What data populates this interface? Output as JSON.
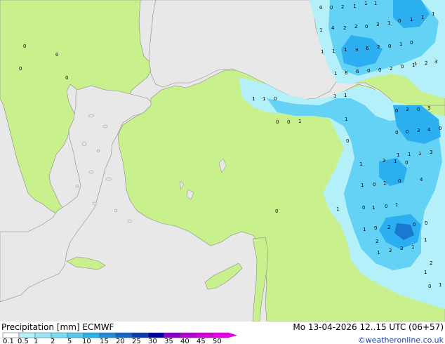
{
  "colors": {
    "sea": "#e8e8e8",
    "land": "#c8f08c",
    "precip_light": "#b4f0fa",
    "precip_mid": "#64d2f5",
    "precip_heavy": "#2baff0",
    "precip_strong": "#1a78d2",
    "coast": "#8c8c8c",
    "credit": "#1a3fb5"
  },
  "footer": {
    "title": "Precipitation [mm] ECMWF",
    "timestamp": "Mo 13-04-2026 12..15 UTC (06+57)",
    "credit": "©weatheronline.co.uk",
    "scale_labels": [
      "0.1",
      "0.5",
      "1",
      "2",
      "5",
      "10",
      "15",
      "20",
      "25",
      "30",
      "35",
      "40",
      "45",
      "50"
    ],
    "scale_colors": [
      "#ffffff",
      "#b4f0fa",
      "#96e6f8",
      "#78dcf5",
      "#50c8f0",
      "#28b4eb",
      "#1e8cdc",
      "#1464c8",
      "#0a3cb4",
      "#0000a0",
      "#8c00c8",
      "#b400d2",
      "#d200dc",
      "#e600e6"
    ]
  },
  "precip_values": [
    {
      "v": "0"
    },
    {
      "v": "0"
    },
    {
      "v": "2"
    },
    {
      "v": "1"
    },
    {
      "v": "1"
    },
    {
      "v": "1"
    },
    {
      "v": "1"
    },
    {
      "v": "4"
    },
    {
      "v": "2"
    },
    {
      "v": "2"
    },
    {
      "v": "0"
    },
    {
      "v": "3"
    },
    {
      "v": "1"
    },
    {
      "v": "0"
    },
    {
      "v": "1"
    },
    {
      "v": "1"
    },
    {
      "v": "1"
    },
    {
      "v": "1"
    },
    {
      "v": "1"
    },
    {
      "v": "1"
    },
    {
      "v": "3"
    },
    {
      "v": "6"
    },
    {
      "v": "2"
    },
    {
      "v": "0"
    },
    {
      "v": "1"
    },
    {
      "v": "0"
    },
    {
      "v": "1"
    },
    {
      "v": "2"
    },
    {
      "v": "3"
    },
    {
      "v": "1"
    },
    {
      "v": "8"
    },
    {
      "v": "6"
    },
    {
      "v": "0"
    },
    {
      "v": "0"
    },
    {
      "v": "2"
    },
    {
      "v": "0"
    },
    {
      "v": "1"
    },
    {
      "v": "1"
    },
    {
      "v": "1"
    },
    {
      "v": "0"
    },
    {
      "v": "1"
    },
    {
      "v": "1"
    },
    {
      "v": "0"
    },
    {
      "v": "3"
    },
    {
      "v": "0"
    },
    {
      "v": "3"
    },
    {
      "v": "0"
    },
    {
      "v": "0"
    },
    {
      "v": "1"
    },
    {
      "v": "1"
    },
    {
      "v": "0"
    },
    {
      "v": "0"
    },
    {
      "v": "3"
    },
    {
      "v": "4"
    },
    {
      "v": "0"
    },
    {
      "v": "0"
    },
    {
      "v": "1"
    },
    {
      "v": "1"
    },
    {
      "v": "1"
    },
    {
      "v": "3"
    },
    {
      "v": "1"
    },
    {
      "v": "2"
    },
    {
      "v": "1"
    },
    {
      "v": "0"
    },
    {
      "v": "1"
    },
    {
      "v": "0"
    },
    {
      "v": "1"
    },
    {
      "v": "0"
    },
    {
      "v": "4"
    },
    {
      "v": "1"
    },
    {
      "v": "0"
    },
    {
      "v": "0"
    },
    {
      "v": "1"
    },
    {
      "v": "1"
    },
    {
      "v": "0"
    },
    {
      "v": "2"
    },
    {
      "v": "0"
    },
    {
      "v": "0"
    },
    {
      "v": "1"
    },
    {
      "v": "2"
    },
    {
      "v": "3"
    },
    {
      "v": "1"
    },
    {
      "v": "2"
    },
    {
      "v": "1"
    },
    {
      "v": "2"
    },
    {
      "v": "1"
    },
    {
      "v": "0"
    },
    {
      "v": "1"
    },
    {
      "v": "0"
    },
    {
      "v": "1"
    },
    {
      "v": "0"
    },
    {
      "v": "0"
    },
    {
      "v": "0"
    },
    {
      "v": "0"
    }
  ]
}
